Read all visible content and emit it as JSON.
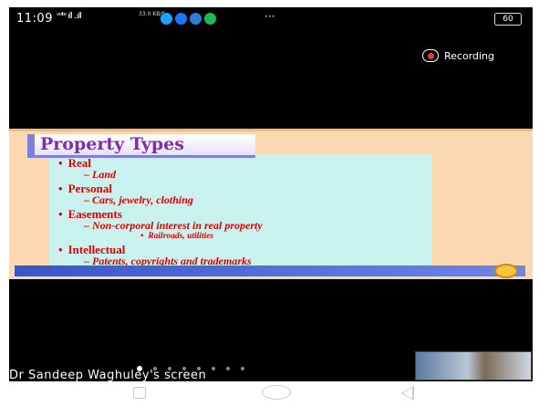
{
  "status_bar": {
    "time": "11:09",
    "signal": "ᵛᵒˡᵗᵉ ıll ..ıll",
    "network_speed": "33.0 KB/S",
    "more": "···",
    "battery": "60",
    "app_icons": [
      {
        "name": "edge-browser-icon",
        "color": "#1aa3ff"
      },
      {
        "name": "facebook-icon",
        "color": "#1877f2"
      },
      {
        "name": "gallery-icon",
        "color": "#2e7dd7"
      },
      {
        "name": "camera-icon",
        "color": "#1db954"
      }
    ]
  },
  "recording": {
    "label": "Recording",
    "color": "#e53935"
  },
  "slide": {
    "title": "Property Types",
    "items": [
      {
        "level": 1,
        "text": "Real"
      },
      {
        "level": 2,
        "text": "Land"
      },
      {
        "level": 1,
        "text": "Personal"
      },
      {
        "level": 2,
        "text": "Cars, jewelry, clothing"
      },
      {
        "level": 1,
        "text": "Easements"
      },
      {
        "level": 2,
        "text": "Non-corporal interest in real property"
      },
      {
        "level": 3,
        "text": "Railroads, utilities"
      },
      {
        "level": 1,
        "text": "Intellectual"
      },
      {
        "level": 2,
        "text": "Patents, copyrights and trademarks"
      }
    ]
  },
  "screen_share": {
    "presenter_label": "Dr Sandeep Waghuley's screen"
  },
  "pager": {
    "count": 8,
    "active_index": 0
  }
}
